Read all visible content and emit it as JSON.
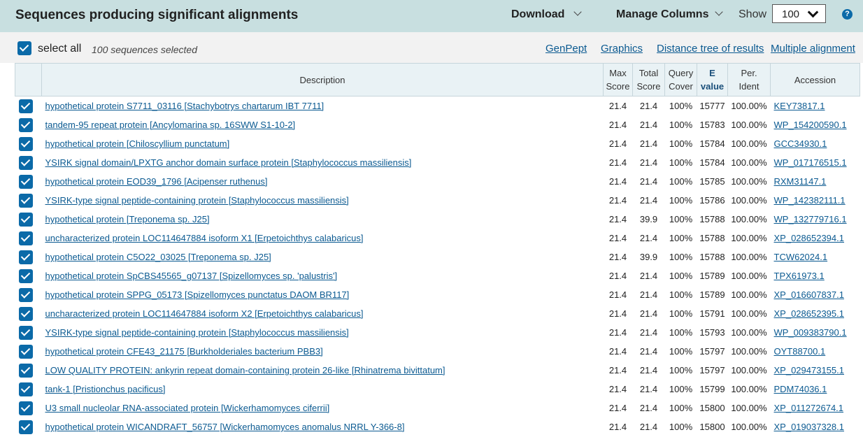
{
  "header": {
    "title": "Sequences producing significant alignments",
    "download": "Download",
    "manage_columns": "Manage Columns",
    "show_label": "Show",
    "show_value": "100",
    "help": "?"
  },
  "toolbar": {
    "select_all": "select all",
    "selected_count": "100 sequences selected",
    "links": [
      "GenPept",
      "Graphics",
      "Distance tree of results",
      "Multiple alignment"
    ]
  },
  "columns": {
    "description": "Description",
    "max_score": [
      "Max",
      "Score"
    ],
    "total_score": [
      "Total",
      "Score"
    ],
    "query_cover": [
      "Query",
      "Cover"
    ],
    "e_value": [
      "E",
      "value"
    ],
    "per_ident": [
      "Per.",
      "Ident"
    ],
    "accession": "Accession"
  },
  "rows": [
    {
      "desc": "hypothetical protein S7711_03116 [Stachybotrys chartarum IBT 7711]",
      "max": "21.4",
      "total": "21.4",
      "cover": "100%",
      "evalue": "15777",
      "ident": "100.00%",
      "acc": "KEY73817.1"
    },
    {
      "desc": "tandem-95 repeat protein [Ancylomarina sp. 16SWW S1-10-2]",
      "max": "21.4",
      "total": "21.4",
      "cover": "100%",
      "evalue": "15783",
      "ident": "100.00%",
      "acc": "WP_154200590.1"
    },
    {
      "desc": "hypothetical protein [Chiloscyllium punctatum]",
      "max": "21.4",
      "total": "21.4",
      "cover": "100%",
      "evalue": "15784",
      "ident": "100.00%",
      "acc": "GCC34930.1"
    },
    {
      "desc": "YSIRK signal domain/LPXTG anchor domain surface protein [Staphylococcus massiliensis]",
      "max": "21.4",
      "total": "21.4",
      "cover": "100%",
      "evalue": "15784",
      "ident": "100.00%",
      "acc": "WP_017176515.1"
    },
    {
      "desc": "hypothetical protein EOD39_1796 [Acipenser ruthenus]",
      "max": "21.4",
      "total": "21.4",
      "cover": "100%",
      "evalue": "15785",
      "ident": "100.00%",
      "acc": "RXM31147.1"
    },
    {
      "desc": "YSIRK-type signal peptide-containing protein [Staphylococcus massiliensis]",
      "max": "21.4",
      "total": "21.4",
      "cover": "100%",
      "evalue": "15786",
      "ident": "100.00%",
      "acc": "WP_142382111.1"
    },
    {
      "desc": "hypothetical protein [Treponema sp. J25]",
      "max": "21.4",
      "total": "39.9",
      "cover": "100%",
      "evalue": "15788",
      "ident": "100.00%",
      "acc": "WP_132779716.1"
    },
    {
      "desc": "uncharacterized protein LOC114647884 isoform X1 [Erpetoichthys calabaricus]",
      "max": "21.4",
      "total": "21.4",
      "cover": "100%",
      "evalue": "15788",
      "ident": "100.00%",
      "acc": "XP_028652394.1"
    },
    {
      "desc": "hypothetical protein C5O22_03025 [Treponema sp. J25]",
      "max": "21.4",
      "total": "39.9",
      "cover": "100%",
      "evalue": "15788",
      "ident": "100.00%",
      "acc": "TCW62024.1"
    },
    {
      "desc": "hypothetical protein SpCBS45565_g07137 [Spizellomyces sp. 'palustris']",
      "max": "21.4",
      "total": "21.4",
      "cover": "100%",
      "evalue": "15789",
      "ident": "100.00%",
      "acc": "TPX61973.1"
    },
    {
      "desc": "hypothetical protein SPPG_05173 [Spizellomyces punctatus DAOM BR117]",
      "max": "21.4",
      "total": "21.4",
      "cover": "100%",
      "evalue": "15789",
      "ident": "100.00%",
      "acc": "XP_016607837.1"
    },
    {
      "desc": "uncharacterized protein LOC114647884 isoform X2 [Erpetoichthys calabaricus]",
      "max": "21.4",
      "total": "21.4",
      "cover": "100%",
      "evalue": "15791",
      "ident": "100.00%",
      "acc": "XP_028652395.1"
    },
    {
      "desc": "YSIRK-type signal peptide-containing protein [Staphylococcus massiliensis]",
      "max": "21.4",
      "total": "21.4",
      "cover": "100%",
      "evalue": "15793",
      "ident": "100.00%",
      "acc": "WP_009383790.1"
    },
    {
      "desc": "hypothetical protein CFE43_21175 [Burkholderiales bacterium PBB3]",
      "max": "21.4",
      "total": "21.4",
      "cover": "100%",
      "evalue": "15797",
      "ident": "100.00%",
      "acc": "OYT88700.1"
    },
    {
      "desc": "LOW QUALITY PROTEIN: ankyrin repeat domain-containing protein 26-like [Rhinatrema bivittatum]",
      "max": "21.4",
      "total": "21.4",
      "cover": "100%",
      "evalue": "15797",
      "ident": "100.00%",
      "acc": "XP_029473155.1"
    },
    {
      "desc": "tank-1 [Pristionchus pacificus]",
      "max": "21.4",
      "total": "21.4",
      "cover": "100%",
      "evalue": "15799",
      "ident": "100.00%",
      "acc": "PDM74036.1"
    },
    {
      "desc": "U3 small nucleolar RNA-associated protein [Wickerhamomyces ciferrii]",
      "max": "21.4",
      "total": "21.4",
      "cover": "100%",
      "evalue": "15800",
      "ident": "100.00%",
      "acc": "XP_011272674.1"
    },
    {
      "desc": "hypothetical protein WICANDRAFT_56757 [Wickerhamomyces anomalus NRRL Y-366-8]",
      "max": "21.4",
      "total": "21.4",
      "cover": "100%",
      "evalue": "15800",
      "ident": "100.00%",
      "acc": "XP_019037328.1"
    }
  ]
}
